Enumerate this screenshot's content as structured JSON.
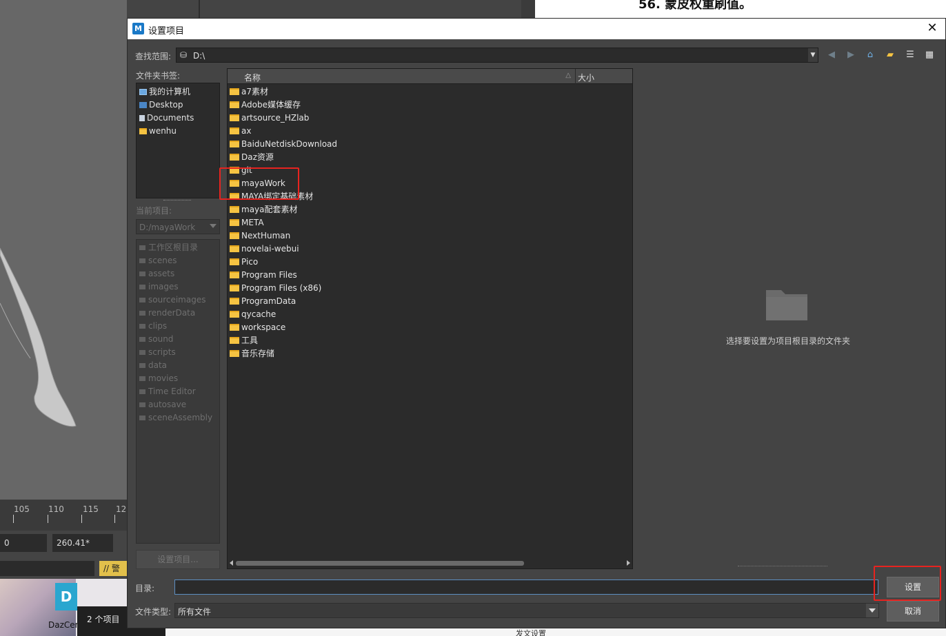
{
  "background": {
    "doc_heading": "56. 蒙皮权重刷值。",
    "timeline_ticks": [
      "105",
      "110",
      "115",
      "12"
    ],
    "range_values": [
      "0",
      "260.41*"
    ],
    "warning_label": "// 警告",
    "desktop_app_label": "DazCen",
    "status_items": "2 个项目",
    "publish_settings": "发文设置"
  },
  "dialog": {
    "title": "设置项目",
    "app_icon_letter": "M",
    "look_in_label": "查找范围:",
    "look_in_value": "D:\\",
    "bookmarks_label": "文件夹书签:",
    "bookmarks": [
      "我的计算机",
      "Desktop",
      "Documents",
      "wenhu"
    ],
    "current_project_label": "当前项目:",
    "current_project_value": "D:/mayaWork",
    "project_tree": [
      "工作区根目录",
      "scenes",
      "assets",
      "images",
      "sourceimages",
      "renderData",
      "clips",
      "sound",
      "scripts",
      "data",
      "movies",
      "Time Editor",
      "autosave",
      "sceneAssembly"
    ],
    "set_project_button_left": "设置项目...",
    "columns": {
      "name": "名称",
      "size": "大小"
    },
    "files": [
      "a7素材",
      "Adobe媒体缓存",
      "artsource_HZlab",
      "ax",
      "BaiduNetdiskDownload",
      "Daz资源",
      "git",
      "mayaWork",
      "MAYA绑定基础素材",
      "maya配套素材",
      "META",
      "NextHuman",
      "novelai-webui",
      "Pico",
      "Program Files",
      "Program Files (x86)",
      "ProgramData",
      "qycache",
      "workspace",
      "工具",
      "音乐存储"
    ],
    "preview_hint": "选择要设置为项目根目录的文件夹",
    "directory_label": "目录:",
    "directory_value": "",
    "set_button": "设置",
    "file_type_label": "文件类型:",
    "file_type_value": "所有文件",
    "cancel_button": "取消"
  },
  "icons": {
    "toolbar": [
      "back-icon",
      "forward-icon",
      "home-icon",
      "new-folder-icon",
      "list-view-icon",
      "detail-view-icon"
    ]
  },
  "colors": {
    "dialog_bg": "#444444",
    "field_bg": "#2b2b2b",
    "folder": "#f5c342",
    "annotation": "#e8231f",
    "focus_border": "#5d8fc2"
  }
}
